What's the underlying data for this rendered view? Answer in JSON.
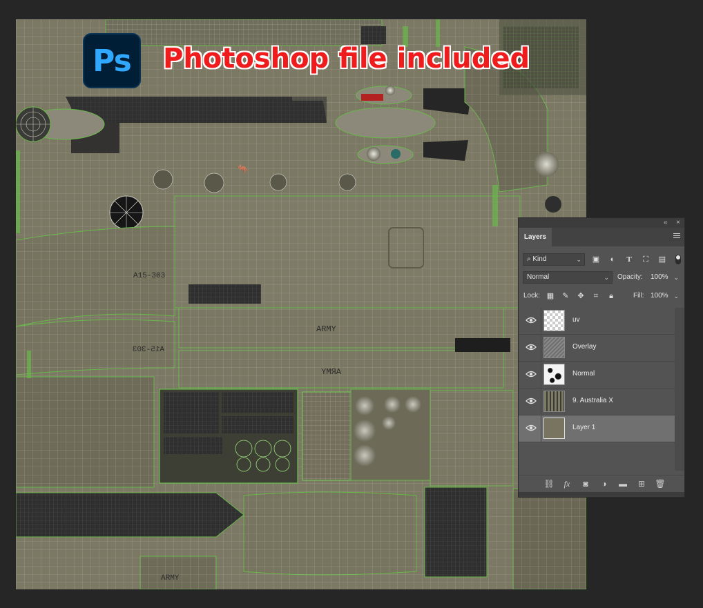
{
  "promo": {
    "logo_text": "Ps",
    "headline": "Photoshop file included",
    "headline_color": "#ee1c1c",
    "logo_color": "#31a8ff"
  },
  "texture": {
    "markings": [
      "A15-303",
      "A15-303",
      "ARMY",
      "ARMY",
      "ARMY"
    ]
  },
  "panel": {
    "collapse_glyph": "«",
    "close_glyph": "×",
    "tab_label": "Layers",
    "filter": {
      "value": "Kind",
      "icons": [
        "image-filter-icon",
        "adjustment-filter-icon",
        "type-filter-icon",
        "shape-filter-icon",
        "smart-object-filter-icon"
      ]
    },
    "blend": {
      "mode": "Normal",
      "opacity_label": "Opacity:",
      "opacity_value": "100%"
    },
    "lock": {
      "label": "Lock:",
      "fill_label": "Fill:",
      "fill_value": "100%"
    },
    "layers": [
      {
        "name": "uv",
        "visible": true,
        "selected": false
      },
      {
        "name": "Overlay",
        "visible": true,
        "selected": false
      },
      {
        "name": "Normal",
        "visible": true,
        "selected": false
      },
      {
        "name": "9. Australia X",
        "visible": true,
        "selected": false
      },
      {
        "name": "Layer 1",
        "visible": true,
        "selected": true
      }
    ],
    "footer_icons": [
      "link-layers-icon",
      "fx-icon",
      "add-mask-icon",
      "adjustment-layer-icon",
      "new-group-icon",
      "new-layer-icon",
      "delete-layer-icon"
    ],
    "fx_label": "fx",
    "colors": {
      "panel_bg": "#535353",
      "selected_row": "#707070"
    }
  }
}
